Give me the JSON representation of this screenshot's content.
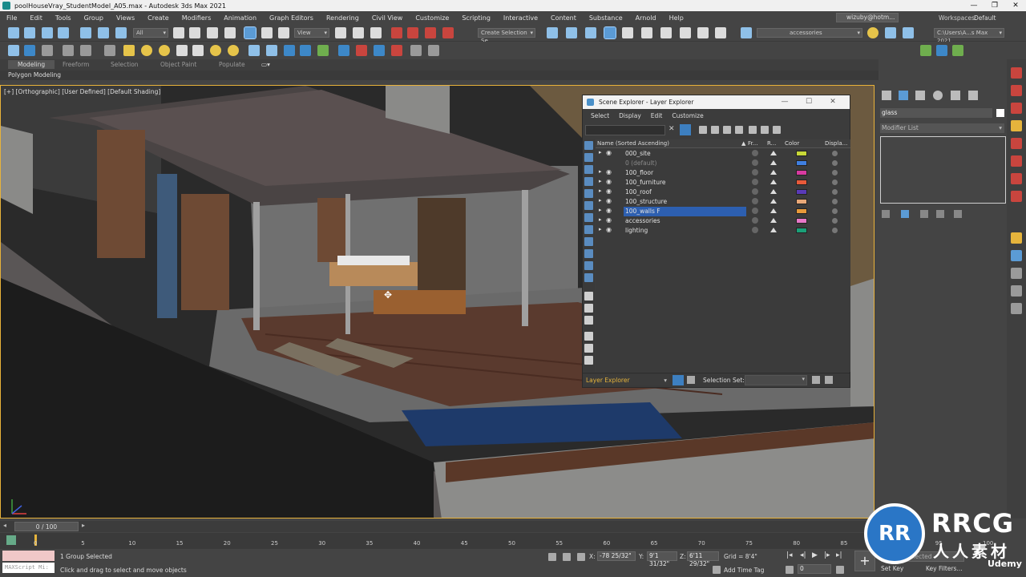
{
  "window": {
    "title": "poolHouseVray_StudentModel_A05.max - Autodesk 3ds Max 2021",
    "controls": [
      "—",
      "❐",
      "✕"
    ]
  },
  "menu": [
    "File",
    "Edit",
    "Tools",
    "Group",
    "Views",
    "Create",
    "Modifiers",
    "Animation",
    "Graph Editors",
    "Rendering",
    "Civil View",
    "Customize",
    "Scripting",
    "Interactive",
    "Content",
    "Substance",
    "Arnold",
    "Help"
  ],
  "user": "wizuby@hotm...",
  "workspace": {
    "label": "Workspaces:",
    "value": "Default"
  },
  "toolbar": {
    "filter": "All",
    "refcoord": "View",
    "create_selection_set": "Create Selection Se",
    "layer_current": "accessories",
    "project_path": "C:\\Users\\A...s Max 2021"
  },
  "ribbon": {
    "tabs": [
      "Modeling",
      "Freeform",
      "Selection",
      "Object Paint",
      "Populate"
    ],
    "active_tab": "Modeling",
    "subpanel": "Polygon Modeling"
  },
  "viewport": {
    "label": "[+] [Orthographic] [User Defined] [Default Shading]"
  },
  "scene_explorer": {
    "title": "Scene Explorer - Layer Explorer",
    "menu": [
      "Select",
      "Display",
      "Edit",
      "Customize"
    ],
    "columns": [
      "Name (Sorted Ascending)",
      "Fr...",
      "R...",
      "Color",
      "Displa..."
    ],
    "layers": [
      {
        "name": "000_site",
        "color": "#c8d838",
        "selected": false,
        "dim": false
      },
      {
        "name": "0 (default)",
        "color": "#3f7fe0",
        "selected": false,
        "dim": true
      },
      {
        "name": "100_floor",
        "color": "#d83aa0",
        "selected": false,
        "dim": false
      },
      {
        "name": "100_furniture",
        "color": "#e85a3a",
        "selected": false,
        "dim": false
      },
      {
        "name": "100_roof",
        "color": "#5a3ab8",
        "selected": false,
        "dim": false
      },
      {
        "name": "100_structure",
        "color": "#e8a878",
        "selected": false,
        "dim": false
      },
      {
        "name": "100_walls F",
        "color": "#e89a3a",
        "selected": true,
        "dim": false
      },
      {
        "name": "accessories",
        "color": "#e878c8",
        "selected": false,
        "dim": false
      },
      {
        "name": "lighting",
        "color": "#1aa078",
        "selected": false,
        "dim": false
      }
    ],
    "mode": "Layer Explorer",
    "selection_set_label": "Selection Set:"
  },
  "command_panel": {
    "object_name": "glass",
    "modifier_list": "Modifier List"
  },
  "timeline": {
    "frame_display": "0 / 100",
    "ticks": [
      "0",
      "5",
      "10",
      "15",
      "20",
      "25",
      "30",
      "35",
      "40",
      "45",
      "50",
      "55",
      "60",
      "65",
      "70",
      "75",
      "80",
      "85",
      "90",
      "95",
      "100"
    ]
  },
  "status": {
    "maxscript": "MAXScript Mi:",
    "selection": "1 Group Selected",
    "prompt": "Click and drag to select and move objects",
    "x_label": "X:",
    "x": "-78 25/32\"",
    "y_label": "Y:",
    "y": "9'1 31/32\"",
    "z_label": "Z:",
    "z": "6'11 29/32\"",
    "grid": "Grid = 8'4\"",
    "add_time_tag": "Add Time Tag",
    "frame": "0",
    "selected_dd": "Selected",
    "set_key": "Set Key",
    "key_filters": "Key Filters..."
  },
  "watermark": {
    "logo": "RR",
    "text": "RRCG",
    "sub": "人人素材",
    "udemy": "Udemy"
  }
}
